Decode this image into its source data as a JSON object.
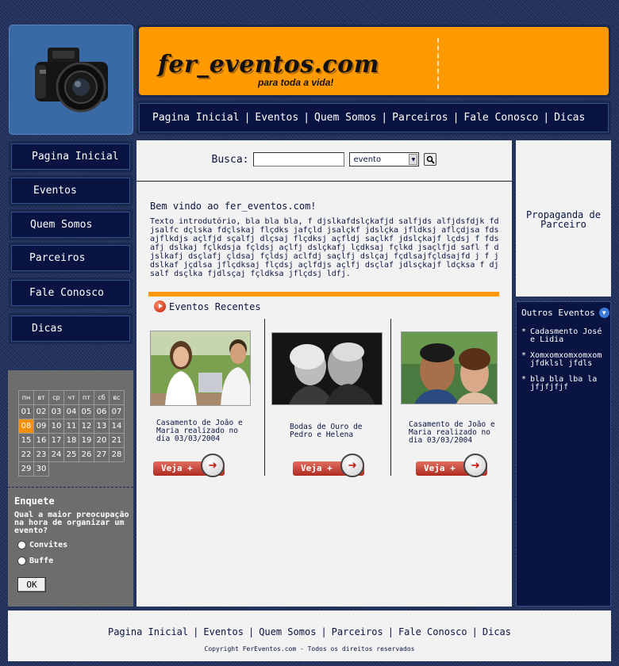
{
  "header": {
    "brand": "fer_eventos.com",
    "tagline": "para toda a vida!"
  },
  "top_nav": [
    "Pagina Inicial",
    "Eventos",
    "Quem Somos",
    "Parceiros",
    "Fale Conosco",
    "Dicas"
  ],
  "left_menu": [
    "Pagina Inicial",
    "Eventos",
    "Quem Somos",
    "Parceiros",
    "Fale Conosco",
    "Dicas"
  ],
  "calendar": {
    "weekdays": [
      "пн",
      "вт",
      "ср",
      "чт",
      "пт",
      "сб",
      "вс"
    ],
    "days": [
      "01",
      "02",
      "03",
      "04",
      "05",
      "06",
      "07",
      "08",
      "09",
      "10",
      "11",
      "12",
      "13",
      "14",
      "15",
      "16",
      "17",
      "18",
      "19",
      "20",
      "21",
      "22",
      "23",
      "24",
      "25",
      "26",
      "27",
      "28",
      "29",
      "30"
    ],
    "highlighted": "08"
  },
  "poll": {
    "title": "Enquete",
    "question": "Qual a maior preocupação na hora de organizar um evento?",
    "options": [
      "Convites",
      "Buffe"
    ],
    "button": "OK"
  },
  "search": {
    "label": "Busca:",
    "value": "",
    "select_value": "evento",
    "button_icon": "search-icon"
  },
  "welcome": {
    "title": "Bem vindo ao fer_eventos.com!",
    "text": " Texto introdutório, bla bla bla, f djslkafdslçkafjd salfjds alfjdsfdjk fdjsalfc dçlska fdçlskaj flçdks jafçld jsalçkf jdslçka jfldksj aflçdjsa fds ajflkdjs açlfjd sçalfj dlçsaj flçdksj açfldj saçlkf jdslçkajf lçdsj f fdsafj dslkaj fçlkdsja fçldsj açlfj dslçkafj lçdksaj fçlkd jsaçlfjd safl f djslkafj dsçlafj çldsaj fçldsj aclfdj saçlfj dslçaj fçdlsajfçldsajfd j f jdslkaf jçdlsa jflçdksaj flçdsj açlfdjs açlfj dsçlaf jdlsçkajf ldçksa f djsalf dsçlka fjdlsçaj fçldksa jflçdsj ldfj."
  },
  "recent": {
    "title": "Eventos Recentes",
    "events": [
      {
        "caption": "Casamento de João e Maria realizado no dia 03/03/2004",
        "button": "Veja +"
      },
      {
        "caption": "Bodas de Ouro de Pedro e Helena",
        "button": "Veja +"
      },
      {
        "caption": "Casamento de João e Maria realizado no dia 03/03/2004",
        "button": "Veja +"
      }
    ]
  },
  "ad": {
    "text": "Propaganda de Parceiro"
  },
  "outros": {
    "title": "Outros Eventos",
    "items": [
      "Cadasmento José e Lidia",
      "Xomxomxomxomxom jfdklsl jfdls",
      "bla bla lba la jfjfjfjf"
    ]
  },
  "footer": {
    "nav": [
      "Pagina Inicial",
      "Eventos",
      "Quem Somos",
      "Parceiros",
      "Fale Conosco",
      "Dicas"
    ],
    "copyright": "Copyright FerEventos.com - Todos os direitos reservados"
  },
  "colors": {
    "navy": "#0a1442",
    "orange": "#ff9a00",
    "panel_gray": "#6d6d6d",
    "content_bg": "#f2f2f2"
  }
}
